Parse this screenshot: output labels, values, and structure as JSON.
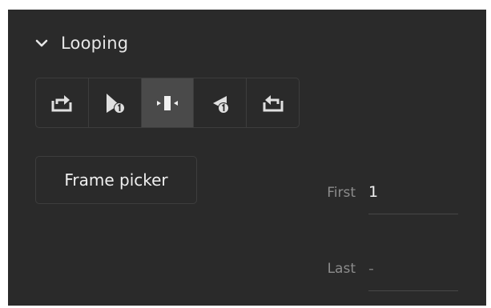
{
  "section": {
    "title": "Looping",
    "expand_icon": "chevron-down-icon"
  },
  "loop_modes": [
    {
      "name": "loop-icon",
      "selected": false
    },
    {
      "name": "play-once-icon",
      "selected": false
    },
    {
      "name": "single-frame-icon",
      "selected": true
    },
    {
      "name": "play-once-reverse-icon",
      "selected": false
    },
    {
      "name": "loop-reverse-icon",
      "selected": false
    }
  ],
  "frame_picker": {
    "label": "Frame picker"
  },
  "first_frame": {
    "label": "First",
    "value": "1"
  },
  "last_frame": {
    "label": "Last",
    "value": "-"
  },
  "colors": {
    "panel_bg": "#2a2a2a",
    "selected_bg": "#4a4a4a",
    "icon": "#e0e0e0"
  }
}
